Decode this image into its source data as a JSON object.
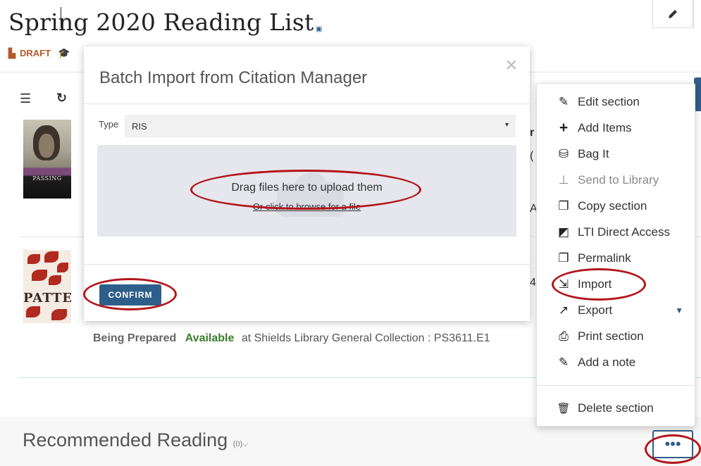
{
  "page": {
    "title": "Spring 2020 Reading List",
    "status_badge": "DRAFT"
  },
  "items": [
    {
      "cover_title": "PASSING"
    },
    {
      "cover_title": "PATTER"
    }
  ],
  "availability": {
    "status_prep": "Being Prepared",
    "status_available": "Available",
    "location": "at Shields Library General Collection : PS3611.E1"
  },
  "section": {
    "title": "Recommended Reading",
    "count": "(0)",
    "more_button": "•••"
  },
  "modal": {
    "title": "Batch Import from Citation Manager",
    "close": "×",
    "type_label": "Type",
    "type_value": "RIS",
    "drop_main": "Drag files here to upload them",
    "drop_sub": "Or click to browse for a file",
    "confirm": "CONFIRM"
  },
  "menu": {
    "items": [
      {
        "label": "Edit section",
        "icon": "pencil-icon",
        "glyph": "✎",
        "enabled": true
      },
      {
        "label": "Add Items",
        "icon": "plus-icon",
        "glyph": "+",
        "enabled": true
      },
      {
        "label": "Bag It",
        "icon": "bag-icon",
        "glyph": "⛁",
        "enabled": true
      },
      {
        "label": "Send to Library",
        "icon": "pin-icon",
        "glyph": "⊥",
        "enabled": false
      },
      {
        "label": "Copy section",
        "icon": "copy-icon",
        "glyph": "❐",
        "enabled": true
      },
      {
        "label": "LTI Direct Access",
        "icon": "lti-icon",
        "glyph": "◩",
        "enabled": true
      },
      {
        "label": "Permalink",
        "icon": "permalink-icon",
        "glyph": "❐",
        "enabled": true
      },
      {
        "label": "Import",
        "icon": "import-icon",
        "glyph": "⇲",
        "enabled": true
      },
      {
        "label": "Export",
        "icon": "export-icon",
        "glyph": "↗",
        "enabled": true
      },
      {
        "label": "Print section",
        "icon": "print-icon",
        "glyph": "⎙",
        "enabled": true
      },
      {
        "label": "Add a note",
        "icon": "pushpin-icon",
        "glyph": "✎",
        "enabled": true
      },
      {
        "label": "Delete section",
        "icon": "trash-icon",
        "glyph": "🗑",
        "enabled": true
      }
    ]
  },
  "colors": {
    "primary": "#2e5f8a",
    "available": "#3a7d2c",
    "draft": "#b5582a",
    "annotation": "#b3161b"
  }
}
